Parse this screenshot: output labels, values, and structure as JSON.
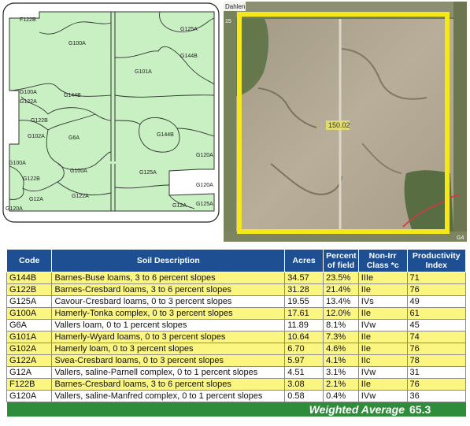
{
  "soil_map": {
    "labels": [
      "F122B",
      "G125A",
      "G100A",
      "G144B",
      "G101A",
      "G100A",
      "G122A",
      "G144B",
      "G122B",
      "G102A",
      "G144B",
      "G6A",
      "G100A",
      "G100A",
      "G120A",
      "G125A",
      "G122B",
      "G122A",
      "G12A",
      "G120A",
      "G125A",
      "G12A",
      "G120A"
    ]
  },
  "aerial": {
    "road_label": "Dahlen",
    "field_label": "150.02",
    "edge_labels": [
      "15",
      "G4"
    ],
    "border_color": "#f4e81a"
  },
  "table": {
    "headers": {
      "code": "Code",
      "description": "Soil Description",
      "acres": "Acres",
      "percent": "Percent of field",
      "class": "Non-Irr Class *c",
      "productivity": "Productivity Index"
    },
    "rows": [
      {
        "code": "G144B",
        "description": "Barnes-Buse loams, 3 to 6 percent slopes",
        "acres": "34.57",
        "percent": "23.5%",
        "class": "IIIe",
        "pi": "71"
      },
      {
        "code": "G122B",
        "description": "Barnes-Cresbard loams, 3 to 6 percent slopes",
        "acres": "31.28",
        "percent": "21.4%",
        "class": "IIe",
        "pi": "76"
      },
      {
        "code": "G125A",
        "description": "Cavour-Cresbard loams, 0 to 3 percent slopes",
        "acres": "19.55",
        "percent": "13.4%",
        "class": "IVs",
        "pi": "49"
      },
      {
        "code": "G100A",
        "description": "Hamerly-Tonka complex, 0 to 3 percent slopes",
        "acres": "17.61",
        "percent": "12.0%",
        "class": "IIe",
        "pi": "61"
      },
      {
        "code": "G6A",
        "description": "Vallers loam, 0 to 1 percent slopes",
        "acres": "11.89",
        "percent": "8.1%",
        "class": "IVw",
        "pi": "45"
      },
      {
        "code": "G101A",
        "description": "Hamerly-Wyard loams, 0 to 3 percent slopes",
        "acres": "10.64",
        "percent": "7.3%",
        "class": "IIe",
        "pi": "74"
      },
      {
        "code": "G102A",
        "description": "Hamerly loam, 0 to 3 percent slopes",
        "acres": "6.70",
        "percent": "4.6%",
        "class": "IIe",
        "pi": "76"
      },
      {
        "code": "G122A",
        "description": "Svea-Cresbard loams, 0 to 3 percent slopes",
        "acres": "5.97",
        "percent": "4.1%",
        "class": "IIc",
        "pi": "78"
      },
      {
        "code": "G12A",
        "description": "Vallers, saline-Parnell complex, 0 to 1 percent slopes",
        "acres": "4.51",
        "percent": "3.1%",
        "class": "IVw",
        "pi": "31"
      },
      {
        "code": "F122B",
        "description": "Barnes-Cresbard loams, 3 to 6 percent slopes",
        "acres": "3.08",
        "percent": "2.1%",
        "class": "IIe",
        "pi": "76"
      },
      {
        "code": "G120A",
        "description": "Vallers, saline-Manfred complex, 0 to 1 percent slopes",
        "acres": "0.58",
        "percent": "0.4%",
        "class": "IVw",
        "pi": "36"
      }
    ],
    "highlighted_rows": [
      0,
      1,
      3,
      5,
      6,
      7,
      9
    ],
    "weighted_average_label": "Weighted Average",
    "weighted_average_value": "65.3"
  },
  "colors": {
    "header_blue": "#1e4f93",
    "highlight_yellow": "#fbf582",
    "weighted_green": "#2f8c3b",
    "map_fill": "#c8f0c2"
  }
}
